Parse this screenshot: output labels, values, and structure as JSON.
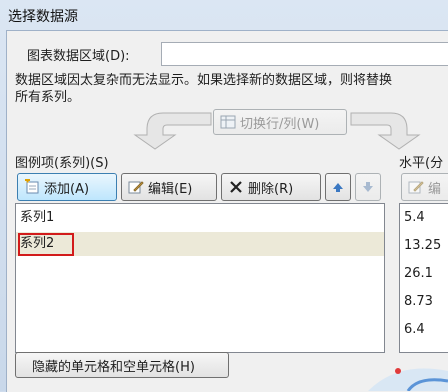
{
  "window": {
    "title": "选择数据源"
  },
  "range": {
    "label": "图表数据区域(D):",
    "value": ""
  },
  "message": {
    "line1": "数据区域因太复杂而无法显示。如果选择新的数据区域，则将替换",
    "line2": "所有系列。"
  },
  "switch_button": {
    "label": "切换行/列(W)"
  },
  "legend": {
    "header": "图例项(系列)(S)",
    "add_label": "添加(A)",
    "edit_label": "编辑(E)",
    "delete_label": "删除(R)",
    "items": [
      "系列1",
      "系列2"
    ]
  },
  "axis": {
    "header": "水平(分",
    "edit_label": "编",
    "items": [
      "5.4",
      "13.25",
      "26.1",
      "8.73",
      "6.4"
    ]
  },
  "hidden_button": {
    "label": "隐藏的单元格和空单元格(H)"
  },
  "colors": {
    "highlight_border": "#d21b1b",
    "selected_row": "#ece9d8",
    "title_bar": "#dbe6f3"
  }
}
